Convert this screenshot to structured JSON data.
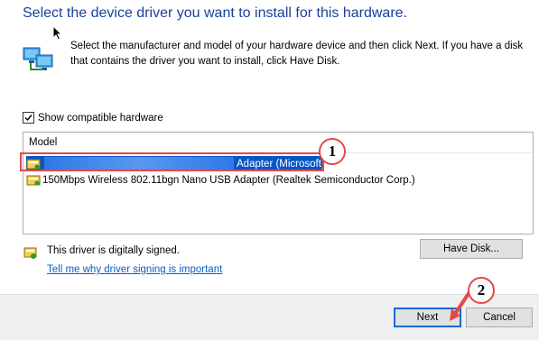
{
  "dialog": {
    "title": "Select the device driver you want to install for this hardware.",
    "intro_text": "Select the manufacturer and model of your hardware device and then click Next. If you have a disk that contains the driver you want to install, click Have Disk."
  },
  "compat": {
    "label": "Show compatible hardware",
    "checked": true
  },
  "model_list": {
    "header": "Model",
    "items": [
      {
        "label": "Adapter (Microsoft)",
        "selected": true
      },
      {
        "label": "150Mbps Wireless 802.11bgn Nano USB Adapter (Realtek Semiconductor Corp.)",
        "selected": false
      }
    ]
  },
  "signing": {
    "status": "This driver is digitally signed.",
    "link": "Tell me why driver signing is important"
  },
  "buttons": {
    "have_disk": "Have Disk...",
    "next": "Next",
    "cancel": "Cancel"
  },
  "annotations": {
    "step1": "1",
    "step2": "2"
  },
  "colors": {
    "title": "#1a3f9c",
    "selection": "#0a55c8",
    "annotation": "#e54848",
    "link": "#0a5fc4"
  }
}
